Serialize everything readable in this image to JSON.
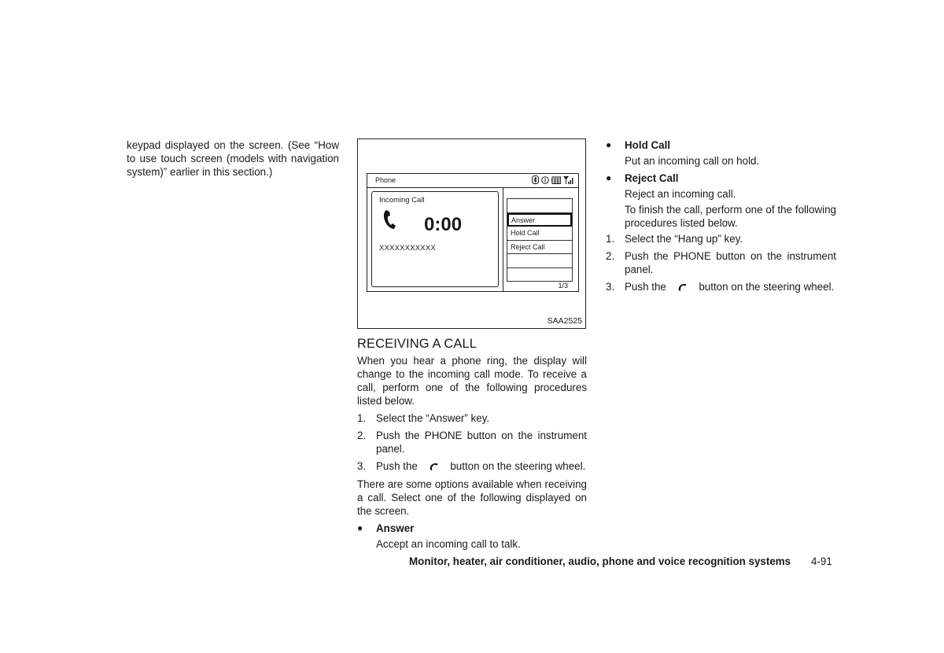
{
  "column1": {
    "paragraph": "keypad displayed on the screen. (See “How to use touch screen (models with navigation system)” earlier in this section.)"
  },
  "figure": {
    "screen_title": "Phone",
    "status_icons": [
      "bluetooth-icon",
      "info-icon",
      "battery-icon",
      "signal-strength-icon"
    ],
    "call_label": "Incoming Call",
    "call_timer": "0:00",
    "caller_id": "XXXXXXXXXXX",
    "menu_items": [
      "",
      "Answer",
      "Hold Call",
      "Reject Call",
      "",
      ""
    ],
    "selected_item": "Answer",
    "page_indicator": "1/3",
    "figure_code": "SAA2525"
  },
  "column2": {
    "heading": "RECEIVING A CALL",
    "intro": "When you hear a phone ring, the display will change to the incoming call mode. To receive a call, perform one of the following procedures listed below.",
    "steps": [
      {
        "num": "1.",
        "text": "Select the “Answer” key."
      },
      {
        "num": "2.",
        "text": "Push the PHONE button on the instrument panel."
      },
      {
        "num": "3.",
        "pre": "Push the",
        "post": "button on the steering wheel."
      }
    ],
    "options_intro": "There are some options available when receiving a call. Select one of the following displayed on the screen.",
    "option1_title": "Answer",
    "option1_desc": "Accept an incoming call to talk."
  },
  "column3": {
    "option2_title": "Hold Call",
    "option2_desc": "Put an incoming call on hold.",
    "option3_title": "Reject Call",
    "option3_desc": "Reject an incoming call.",
    "finish_intro": "To finish the call, perform one of the following procedures listed below.",
    "steps": [
      {
        "num": "1.",
        "text": "Select the “Hang up” key."
      },
      {
        "num": "2.",
        "text": "Push the PHONE button on the instrument panel."
      },
      {
        "num": "3.",
        "pre": "Push the",
        "post": "button on the steering wheel."
      }
    ]
  },
  "footer": {
    "section_title": "Monitor, heater, air conditioner, audio, phone and voice recognition systems",
    "page_number": "4-91"
  }
}
